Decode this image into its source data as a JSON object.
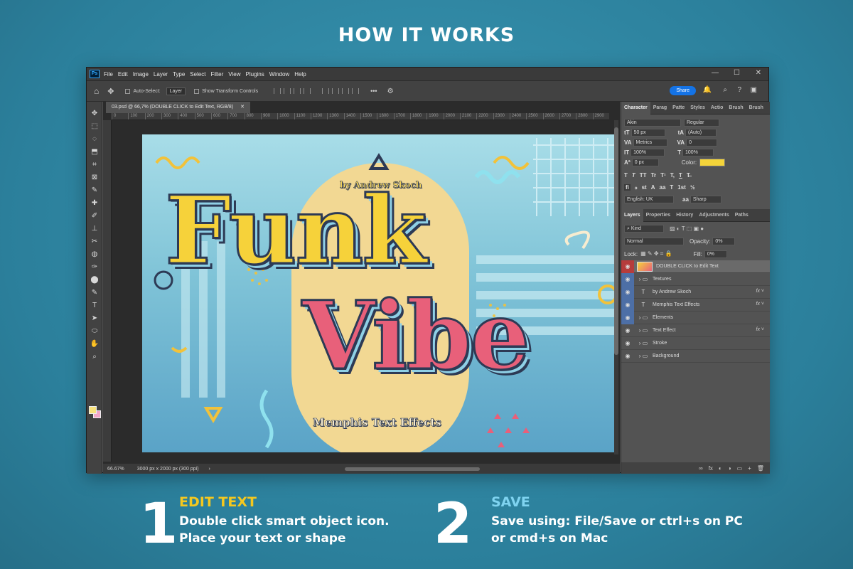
{
  "headline": "HOW IT WORKS",
  "photoshop": {
    "logo": "Ps",
    "menu": [
      "File",
      "Edit",
      "Image",
      "Layer",
      "Type",
      "Select",
      "Filter",
      "View",
      "Plugins",
      "Window",
      "Help"
    ],
    "window_controls": {
      "minimize": "—",
      "maximize": "☐",
      "close": "✕"
    },
    "options_bar": {
      "home_icon": "⌂",
      "move_icon": "✥",
      "auto_select_label": "Auto-Select:",
      "auto_select_value": "Layer",
      "show_transform_label": "Show Transform Controls",
      "more": "•••",
      "gear_icon": "⚙",
      "share": "Share",
      "bell_icon": "🔔",
      "search_icon": "⌕",
      "help_icon": "?",
      "panels_icon": "▣"
    },
    "tools": [
      "✥",
      "⬚",
      "◌",
      "⬒",
      "⌗",
      "⊠",
      "✎",
      "✚",
      "✐",
      "⊥",
      "✂",
      "◍",
      "✑",
      "⬤",
      "✎",
      "T",
      "➤",
      "⬭",
      "✋",
      "⌕"
    ],
    "document": {
      "tab": "03.psd @ 66,7% (DOUBLE CLICK to Edit Text, RGB/8)",
      "tab_close": "✕",
      "ruler_marks": [
        "0",
        "100",
        "200",
        "300",
        "400",
        "500",
        "600",
        "700",
        "800",
        "900",
        "1000",
        "1100",
        "1200",
        "1300",
        "1400",
        "1500",
        "1600",
        "1700",
        "1800",
        "1900",
        "2000",
        "2100",
        "2200",
        "2300",
        "2400",
        "2500",
        "2600",
        "2700",
        "2800",
        "2900"
      ],
      "zoom": "66.67%",
      "doc_info": "3000 px x 2000 px (300 ppi)"
    },
    "artwork": {
      "line1": "Funk",
      "line2": "Vibe",
      "byline": "by Andrew Skoch",
      "tagline": "Memphis Text Effects"
    },
    "character_panel": {
      "tabs": [
        "Character",
        "Parag",
        "Patte",
        "Styles",
        "Actio",
        "Brush",
        "Brush"
      ],
      "font_family": "Akin",
      "font_style": "Regular",
      "font_size": "50 px",
      "leading": "(Auto)",
      "kerning": "Metrics",
      "tracking": "0",
      "vertical_scale": "100%",
      "horizontal_scale": "100%",
      "baseline_shift": "0 px",
      "color_label": "Color:",
      "color_value": "#f4d43a",
      "type_buttons": [
        "T",
        "T",
        "TT",
        "Tr",
        "T¹",
        "T,",
        "T",
        "T̶"
      ],
      "ot_buttons": [
        "fi",
        "ℴ",
        "st",
        "A",
        "aa",
        "T",
        "1st",
        "½"
      ],
      "language": "English: UK",
      "antialias": "Sharp"
    },
    "layers_panel": {
      "tabs": [
        "Layers",
        "Properties",
        "History",
        "Adjustments",
        "Paths"
      ],
      "filter_kind": "Kind",
      "blend_mode": "Normal",
      "opacity_label": "Opacity:",
      "opacity_value": "0%",
      "lock_label": "Lock:",
      "fill_label": "Fill:",
      "fill_value": "0%",
      "layers": [
        {
          "name": "DOUBLE CLICK to Edit Text",
          "type": "smart",
          "eye": "red",
          "selected": true,
          "fx": false
        },
        {
          "name": "Textures",
          "type": "group",
          "eye": "blue",
          "selected": false,
          "fx": false
        },
        {
          "name": "by Andrew Skoch",
          "type": "text",
          "eye": "blue",
          "selected": false,
          "fx": true
        },
        {
          "name": "Memphis Text Effects",
          "type": "text",
          "eye": "blue",
          "selected": false,
          "fx": true
        },
        {
          "name": "Elements",
          "type": "group",
          "eye": "blue",
          "selected": false,
          "fx": false
        },
        {
          "name": "Text Effect",
          "type": "group",
          "eye": "none",
          "selected": false,
          "fx": true
        },
        {
          "name": "Stroke",
          "type": "group",
          "eye": "none",
          "selected": false,
          "fx": false
        },
        {
          "name": "Background",
          "type": "group",
          "eye": "none",
          "selected": false,
          "fx": false
        }
      ],
      "footer_icons": [
        "∞",
        "fx",
        "◐",
        "◑",
        "▭",
        "+",
        "🗑"
      ]
    }
  },
  "steps": [
    {
      "number": "1",
      "title": "EDIT TEXT",
      "line1": "Double click smart object icon.",
      "line2": "Place your text or shape"
    },
    {
      "number": "2",
      "title": "SAVE",
      "line1": "Save using: File/Save or ctrl+s on PC",
      "line2": "or cmd+s on Mac"
    }
  ]
}
